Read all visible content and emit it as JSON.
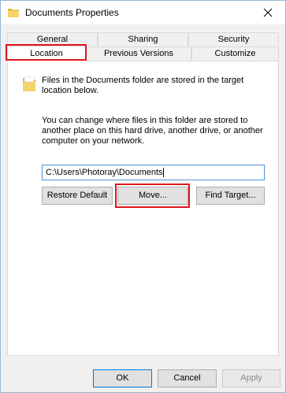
{
  "window": {
    "title": "Documents Properties",
    "title_icon": "folder-icon",
    "close_icon": "close-icon"
  },
  "tabs": {
    "row1": [
      "General",
      "Sharing",
      "Security"
    ],
    "row2": [
      "Location",
      "Previous Versions",
      "Customize"
    ],
    "active": "Location"
  },
  "location": {
    "info_line1": "Files in the Documents folder are stored in the target",
    "info_line2": "location below.",
    "desc_line1": "You can change where files in this folder are stored to",
    "desc_line2": "another place on this hard drive, another drive, or another",
    "desc_line3": "computer on your network.",
    "path_value": "C:\\Users\\Photoray\\Documents",
    "restore_default_label": "Restore Default",
    "move_label": "Move...",
    "find_target_label": "Find Target..."
  },
  "footer": {
    "ok_label": "OK",
    "cancel_label": "Cancel",
    "apply_label": "Apply"
  },
  "colors": {
    "highlight": "#e0161c",
    "focus_border": "#0078d7",
    "folder_yellow": "#f6d36b"
  }
}
